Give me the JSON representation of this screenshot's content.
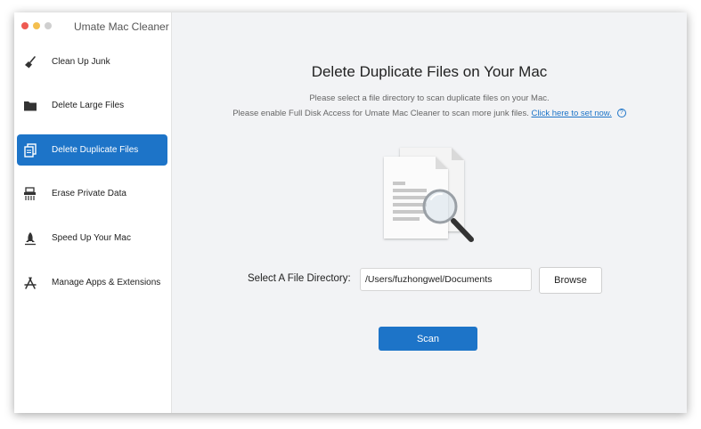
{
  "app": {
    "title": "Umate Mac Cleaner",
    "accent_color": "#1d74c8"
  },
  "sidebar": {
    "items": [
      {
        "label": "Clean Up Junk",
        "icon": "broom-icon",
        "active": false
      },
      {
        "label": "Delete Large Files",
        "icon": "folder-icon",
        "active": false
      },
      {
        "label": "Delete Duplicate Files",
        "icon": "duplicate-files-icon",
        "active": true
      },
      {
        "label": "Erase Private Data",
        "icon": "shredder-icon",
        "active": false
      },
      {
        "label": "Speed Up Your Mac",
        "icon": "rocket-icon",
        "active": false
      },
      {
        "label": "Manage Apps & Extensions",
        "icon": "app-store-icon",
        "active": false
      }
    ]
  },
  "main": {
    "heading": "Delete Duplicate Files on Your Mac",
    "description_line1": "Please select a file directory to scan duplicate files on your Mac.",
    "description_line2": "Please enable Full Disk Access for Umate Mac Cleaner to scan more junk files.",
    "set_now_link": "Click here to set now.",
    "help_glyph": "?",
    "illustration_icon": "duplicate-files-magnifier-icon",
    "directory_label": "Select A File Directory:",
    "directory_value": "/Users/fuzhongwel/Documents",
    "browse_label": "Browse",
    "scan_label": "Scan"
  }
}
